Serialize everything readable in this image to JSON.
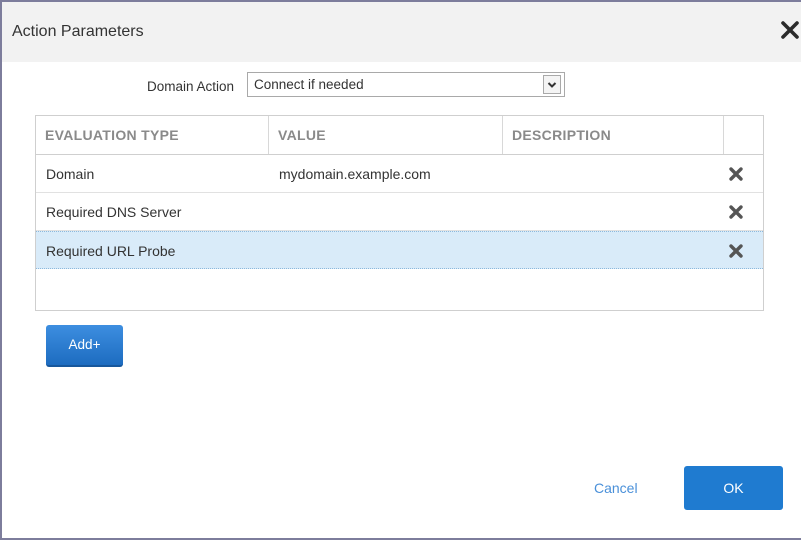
{
  "dialog": {
    "title": "Action Parameters"
  },
  "domain_action": {
    "label": "Domain Action",
    "selected": "Connect if needed"
  },
  "table": {
    "headers": [
      "EVALUATION TYPE",
      "VALUE",
      "DESCRIPTION"
    ],
    "rows": [
      {
        "type": "Domain",
        "value": "mydomain.example.com",
        "description": ""
      },
      {
        "type": "Required DNS Server",
        "value": "",
        "description": ""
      },
      {
        "type": "Required URL Probe",
        "value": "",
        "description": ""
      }
    ],
    "selected_row": 3
  },
  "buttons": {
    "add": "Add+",
    "cancel": "Cancel",
    "ok": "OK"
  },
  "icons": {
    "close": "close-icon",
    "delete": "delete-icon",
    "dropdown": "chevron-down-icon"
  },
  "colors": {
    "primary": "#1f7bd0",
    "selected_row": "#d9ebf9",
    "link": "#4a90d9"
  }
}
